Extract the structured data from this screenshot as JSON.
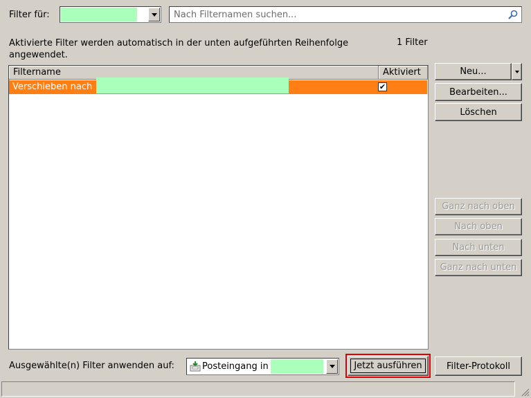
{
  "header": {
    "filter_for_label": "Filter für:",
    "search_placeholder": "Nach Filternamen suchen...",
    "description": "Aktivierte Filter werden automatisch in der unten aufgeführten Reihenfolge angewendet.",
    "filter_count": "1 Filter"
  },
  "list": {
    "columns": [
      "Filtername",
      "Aktiviert"
    ],
    "rows": [
      {
        "name": "Verschieben nach",
        "enabled": true
      }
    ]
  },
  "side_buttons": {
    "new": "Neu...",
    "edit": "Bearbeiten...",
    "delete": "Löschen",
    "move_top": "Ganz nach oben",
    "move_up": "Nach oben",
    "move_down": "Nach unten",
    "move_bottom": "Ganz nach unten"
  },
  "footer": {
    "apply_label": "Ausgewählte(n) Filter anwenden auf:",
    "apply_target": "Posteingang in",
    "run_now": "Jetzt ausführen",
    "filter_log": "Filter-Protokoll"
  },
  "colors": {
    "selection": "#ff7f14",
    "highlight_frame": "#e00000",
    "redaction": "#aaffbb"
  },
  "icons": {
    "search": "magnifier-icon",
    "inbox": "inbox-icon"
  }
}
